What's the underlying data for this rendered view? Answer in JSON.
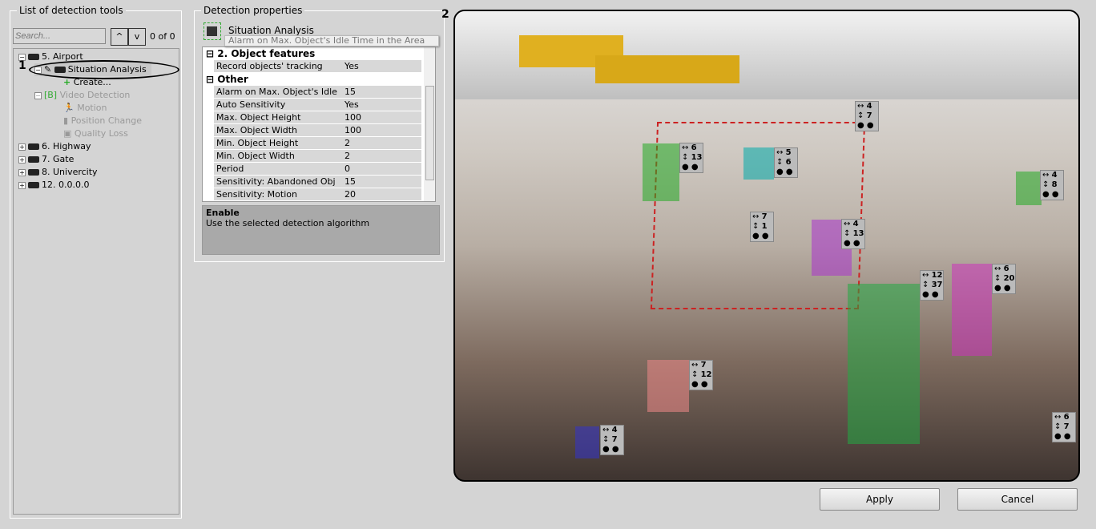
{
  "left_panel": {
    "title": "List of detection tools",
    "search_placeholder": "Search...",
    "counter": "0 of 0",
    "tree": [
      "5. Airport",
      "Situation Analysis",
      "Create...",
      "Video Detection",
      "Motion",
      "Position Change",
      "Quality Loss",
      "6. Highway",
      "7. Gate",
      "8. Univercity",
      "12. 0.0.0.0"
    ],
    "annotation": "1"
  },
  "props": {
    "title": "Detection properties",
    "tool_name": "Situation Analysis",
    "sections": [
      {
        "name": "2. Object features",
        "rows": [
          [
            "Record objects' tracking",
            "Yes"
          ]
        ]
      },
      {
        "name": "Other",
        "rows": [
          [
            "Alarm on Max. Object's Idle",
            "15"
          ],
          [
            "Auto Sensitivity",
            "Yes"
          ],
          [
            "Max. Object Height",
            "100"
          ],
          [
            "Max. Object Width",
            "100"
          ],
          [
            "Min. Object Height",
            "2"
          ],
          [
            "Min. Object Width",
            "2"
          ],
          [
            "Period",
            "0"
          ],
          [
            "Sensitivity: Abandoned Obj",
            "15"
          ],
          [
            "Sensitivity: Motion",
            "20"
          ]
        ]
      }
    ],
    "tooltip": "Alarm on Max. Object's Idle Time in the Area",
    "desc_title": "Enable",
    "desc_text": "Use the selected detection algorithm"
  },
  "video": {
    "annotation": "2",
    "objects": [
      [
        "4",
        "7"
      ],
      [
        "6",
        "13"
      ],
      [
        "5",
        "6"
      ],
      [
        "7",
        "1"
      ],
      [
        "4",
        "13"
      ],
      [
        "4",
        "8"
      ],
      [
        "12",
        "37"
      ],
      [
        "6",
        "20"
      ],
      [
        "7",
        "12"
      ],
      [
        "4",
        "7"
      ],
      [
        "6",
        "7"
      ]
    ]
  },
  "buttons": {
    "apply": "Apply",
    "cancel": "Cancel"
  }
}
